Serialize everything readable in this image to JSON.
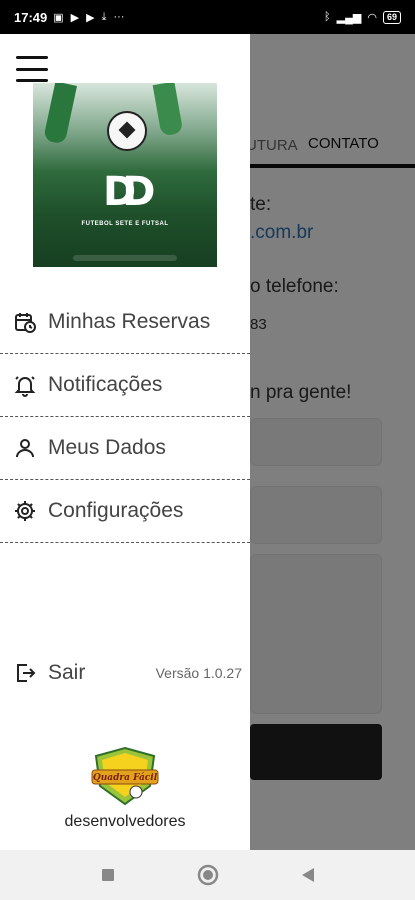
{
  "status_bar": {
    "time": "17:49",
    "battery": "69"
  },
  "background": {
    "tabs": [
      "UTURA",
      "CONTATO"
    ],
    "lines": {
      "site_label": "te:",
      "site_link": ".com.br",
      "phone_label": "o telefone:",
      "phone_value": "83",
      "message": "n pra gente!"
    }
  },
  "drawer": {
    "logo_caption": "FUTEBOL SETE E FUTSAL",
    "menu": [
      {
        "label": "Minhas Reservas",
        "icon": "calendar-clock-icon"
      },
      {
        "label": "Notificações",
        "icon": "bell-icon"
      },
      {
        "label": "Meus Dados",
        "icon": "user-icon"
      },
      {
        "label": "Configurações",
        "icon": "gear-icon"
      }
    ],
    "logout_label": "Sair",
    "version": "Versão 1.0.27",
    "developer_label": "desenvolvedores",
    "developer_logo_text": "Quadra Fácil"
  },
  "colors": {
    "link": "#2a72b8",
    "scrim": "rgba(0,0,0,0.5)"
  }
}
